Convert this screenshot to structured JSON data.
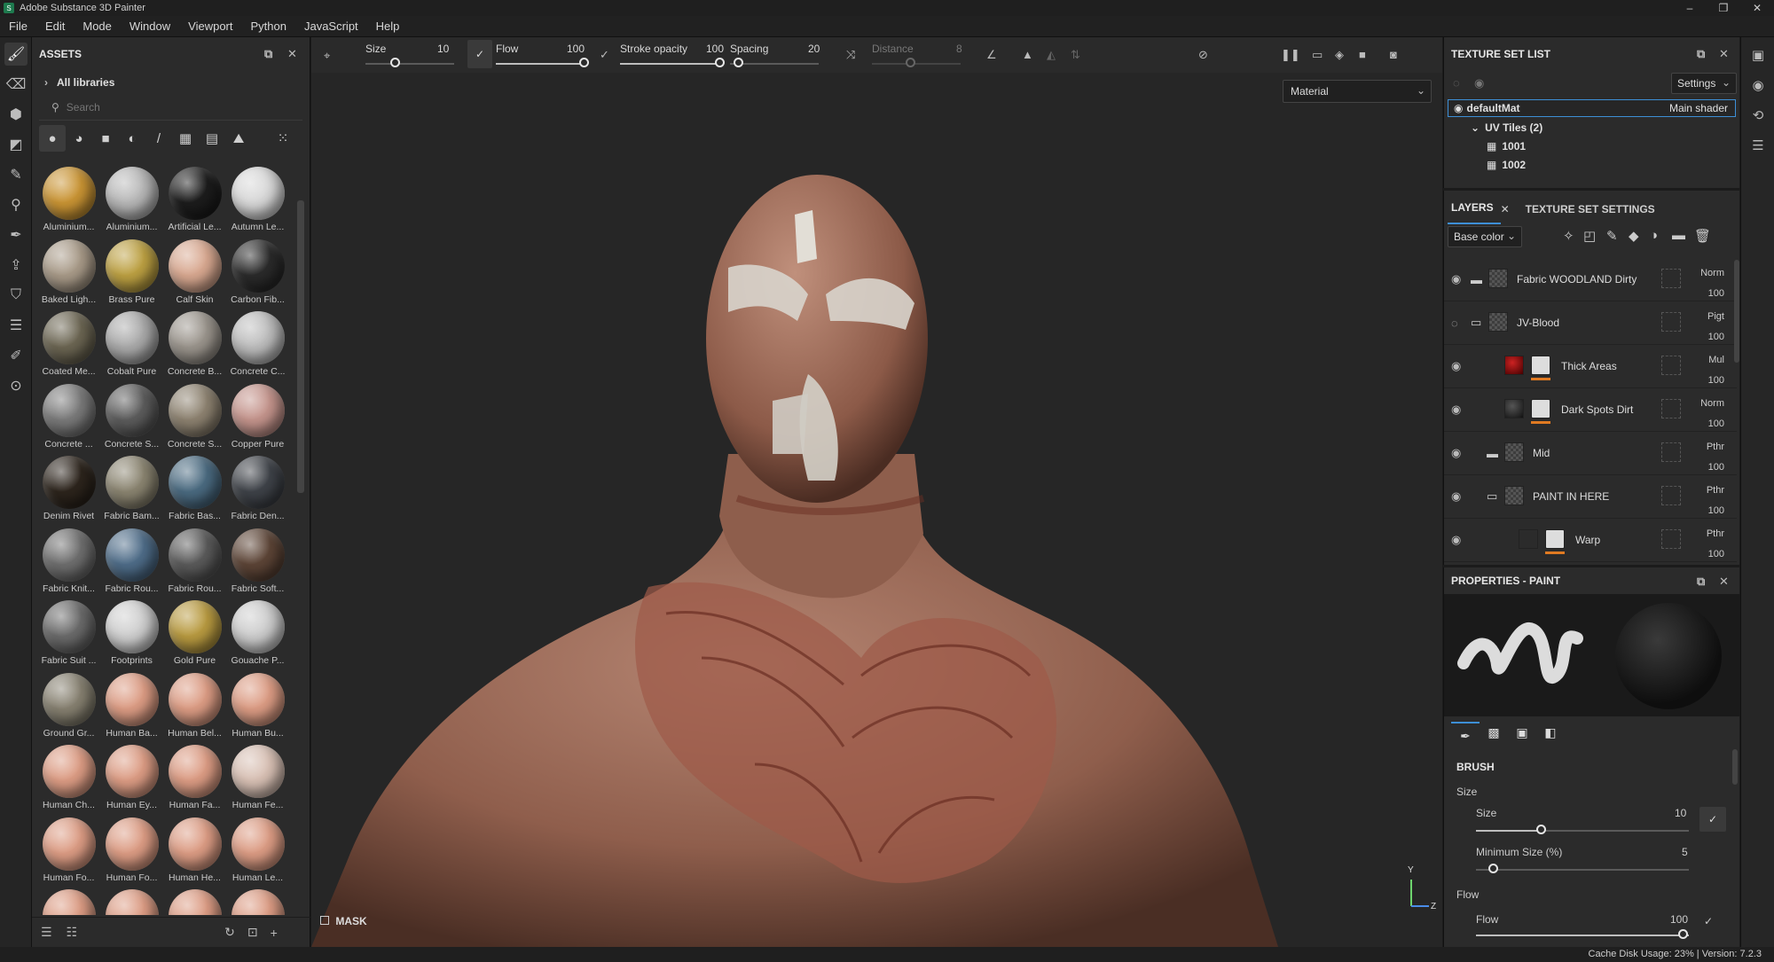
{
  "window": {
    "title": "Adobe Substance 3D Painter"
  },
  "menu": [
    "File",
    "Edit",
    "Mode",
    "Window",
    "Viewport",
    "Python",
    "JavaScript",
    "Help"
  ],
  "assets": {
    "title": "ASSETS",
    "all_libraries": "All libraries",
    "search_placeholder": "Search",
    "items": [
      {
        "name": "Aluminium...",
        "color": "#c99434"
      },
      {
        "name": "Aluminium...",
        "color": "#b8b8b8"
      },
      {
        "name": "Artificial Le...",
        "color": "#1c1c1c"
      },
      {
        "name": "Autumn Le...",
        "color": "#d8d8d8"
      },
      {
        "name": "Baked Ligh...",
        "color": "#a89a88"
      },
      {
        "name": "Brass Pure",
        "color": "#bca042"
      },
      {
        "name": "Calf Skin",
        "color": "#d8a890"
      },
      {
        "name": "Carbon Fib...",
        "color": "#2a2a2a"
      },
      {
        "name": "Coated Me...",
        "color": "#6b6552"
      },
      {
        "name": "Cobalt Pure",
        "color": "#aaaaaa"
      },
      {
        "name": "Concrete B...",
        "color": "#9a948c"
      },
      {
        "name": "Concrete C...",
        "color": "#bdbdbd"
      },
      {
        "name": "Concrete ...",
        "color": "#7a7a7a"
      },
      {
        "name": "Concrete S...",
        "color": "#5c5c5c"
      },
      {
        "name": "Concrete S...",
        "color": "#8d8270"
      },
      {
        "name": "Copper Pure",
        "color": "#c4948c"
      },
      {
        "name": "Denim Rivet",
        "color": "#2c241c"
      },
      {
        "name": "Fabric Bam...",
        "color": "#8a8470"
      },
      {
        "name": "Fabric Bas...",
        "color": "#4a6a80"
      },
      {
        "name": "Fabric Den...",
        "color": "#3e4248"
      },
      {
        "name": "Fabric Knit...",
        "color": "#6e6e6e"
      },
      {
        "name": "Fabric Rou...",
        "color": "#4e6c88"
      },
      {
        "name": "Fabric Rou...",
        "color": "#5a5a5a"
      },
      {
        "name": "Fabric Soft...",
        "color": "#5c4436"
      },
      {
        "name": "Fabric Suit ...",
        "color": "#6a6a6a"
      },
      {
        "name": "Footprints",
        "color": "#cfcfcf"
      },
      {
        "name": "Gold Pure",
        "color": "#b89a40"
      },
      {
        "name": "Gouache P...",
        "color": "#cdcdcd"
      },
      {
        "name": "Ground Gr...",
        "color": "#868070"
      },
      {
        "name": "Human Ba...",
        "color": "#dc9c84"
      },
      {
        "name": "Human Bel...",
        "color": "#dc9c84"
      },
      {
        "name": "Human Bu...",
        "color": "#dc9c84"
      },
      {
        "name": "Human Ch...",
        "color": "#dc9c84"
      },
      {
        "name": "Human Ey...",
        "color": "#dc9c84"
      },
      {
        "name": "Human Fa...",
        "color": "#dc9c84"
      },
      {
        "name": "Human Fe...",
        "color": "#d8c0b4"
      },
      {
        "name": "Human Fo...",
        "color": "#dc9c84"
      },
      {
        "name": "Human Fo...",
        "color": "#dc9c84"
      },
      {
        "name": "Human He...",
        "color": "#dc9c84"
      },
      {
        "name": "Human Le...",
        "color": "#dc9c84"
      },
      {
        "name": "",
        "color": "#dc9c84"
      },
      {
        "name": "",
        "color": "#dc9c84"
      },
      {
        "name": "",
        "color": "#dc9c84"
      },
      {
        "name": "",
        "color": "#dc9c84"
      }
    ]
  },
  "toolbar": {
    "size_label": "Size",
    "size_val": "10",
    "flow_label": "Flow",
    "flow_val": "100",
    "stroke_label": "Stroke opacity",
    "stroke_val": "100",
    "spacing_label": "Spacing",
    "spacing_val": "20",
    "distance_label": "Distance",
    "distance_val": "8"
  },
  "viewport": {
    "material_select": "Material",
    "mask_label": "MASK",
    "axis_y": "Y",
    "axis_z": "Z"
  },
  "texture_set": {
    "title": "TEXTURE SET LIST",
    "settings": "Settings",
    "material": "defaultMat",
    "shader": "Main shader",
    "uv_tiles": "UV Tiles (2)",
    "tiles": [
      "1001",
      "1002"
    ]
  },
  "layers": {
    "tab_layers": "LAYERS",
    "tab_tss": "TEXTURE SET SETTINGS",
    "channel": "Base color",
    "rows": [
      {
        "name": "Fabric WOODLAND Dirty",
        "blend": "Norm",
        "opacity": "100"
      },
      {
        "name": "JV-Blood",
        "blend": "Pigt",
        "opacity": "100"
      },
      {
        "name": "Thick Areas",
        "blend": "Mul",
        "opacity": "100"
      },
      {
        "name": "Dark Spots Dirt",
        "blend": "Norm",
        "opacity": "100"
      },
      {
        "name": "Mid",
        "blend": "Pthr",
        "opacity": "100"
      },
      {
        "name": "PAINT IN HERE",
        "blend": "Pthr",
        "opacity": "100"
      },
      {
        "name": "Warp",
        "blend": "Pthr",
        "opacity": "100"
      }
    ]
  },
  "properties": {
    "title": "PROPERTIES - PAINT",
    "brush_heading": "BRUSH",
    "size_group": "Size",
    "size_label": "Size",
    "size_val": "10",
    "minsize_label": "Minimum Size (%)",
    "minsize_val": "5",
    "flow_group": "Flow",
    "flow_label": "Flow",
    "flow_val": "100"
  },
  "status": {
    "text": "Cache Disk Usage: 23% | Version: 7.2.3"
  }
}
